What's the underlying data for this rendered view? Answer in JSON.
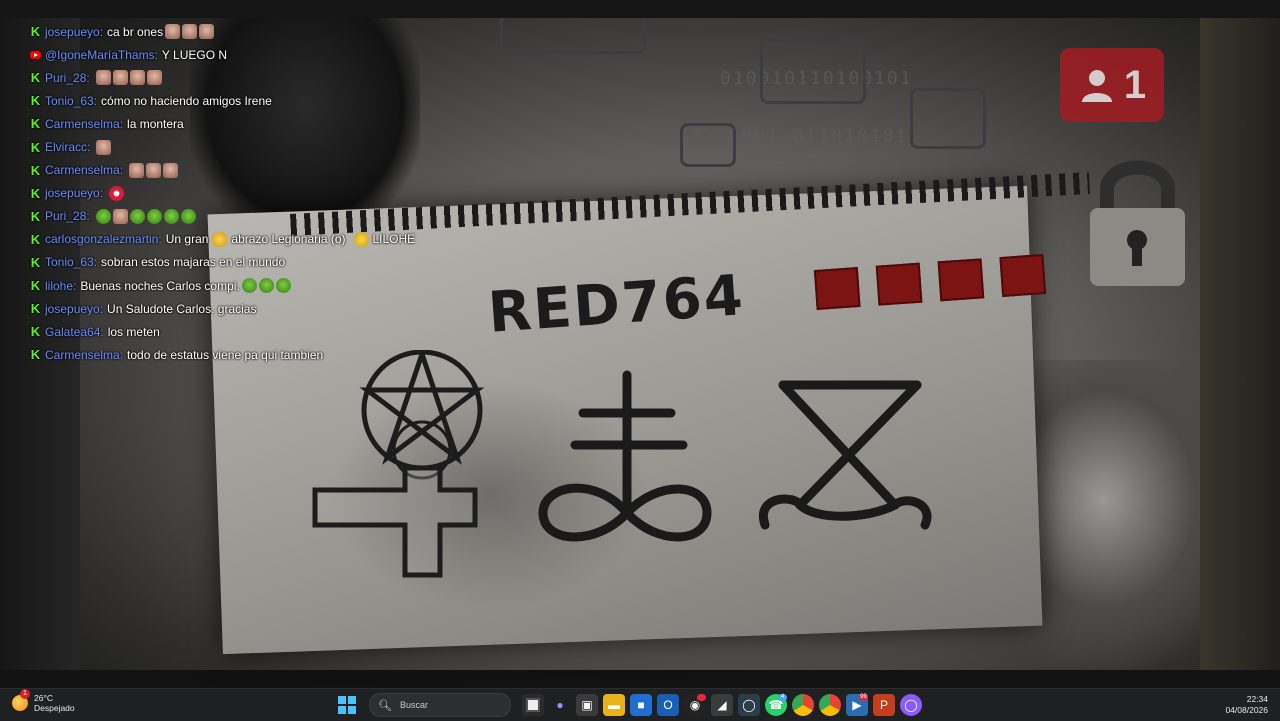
{
  "video": {
    "title_text": "RED764",
    "notify_count": "1"
  },
  "chat": {
    "messages": [
      {
        "platform": "kick",
        "user": "josepueyo:",
        "text": "ca br ones",
        "emotes": [
          "face",
          "face",
          "face"
        ]
      },
      {
        "platform": "youtube",
        "user": "@IgoneMaríaThams:",
        "text": "Y LUEGO N",
        "emotes": []
      },
      {
        "platform": "kick",
        "user": "Puri_28:",
        "text": "",
        "emotes": [
          "face",
          "face",
          "face",
          "face"
        ]
      },
      {
        "platform": "kick",
        "user": "Tonio_63:",
        "text": "cómo no haciendo amigos Irene",
        "emotes": []
      },
      {
        "platform": "kick",
        "user": "Carmenselma:",
        "text": "la montera",
        "emotes": []
      },
      {
        "platform": "kick",
        "user": "Elviracc:",
        "text": "",
        "emotes": [
          "face"
        ]
      },
      {
        "platform": "kick",
        "user": "Carmenselma:",
        "text": "",
        "emotes": [
          "face",
          "face",
          "face"
        ]
      },
      {
        "platform": "kick",
        "user": "josepueyo:",
        "text": "",
        "emotes": [
          "red"
        ]
      },
      {
        "platform": "kick",
        "user": "Puri_28:",
        "text": "",
        "emotes": [
          "green",
          "face",
          "green",
          "green",
          "green",
          "green"
        ]
      },
      {
        "platform": "kick",
        "user": "carlosgonzalezmartin:",
        "text": "Un gran",
        "text2": "abrazo Legionaria (o)",
        "text3": "LILOHE",
        "emotes": []
      },
      {
        "platform": "kick",
        "user": "Tonio_63:",
        "text": "sobran estos majaras en el mundo",
        "emotes": []
      },
      {
        "platform": "kick",
        "user": "lilohe:",
        "text": "Buenas noches Carlos compi.",
        "emotes": [
          "green",
          "green",
          "green"
        ]
      },
      {
        "platform": "kick",
        "user": "josepueyo:",
        "text": "Un Saludote Carlos. gracias",
        "emotes": []
      },
      {
        "platform": "kick",
        "user": "Galatea64:",
        "text": "los meten",
        "emotes": []
      },
      {
        "platform": "kick",
        "user": "Carmenselma:",
        "text": "todo de estatus viene pa qui tambien",
        "emotes": []
      }
    ]
  },
  "taskbar": {
    "weather_temp": "26°C",
    "weather_desc": "Despejado",
    "weather_badge": "1",
    "search_placeholder": "Buscar",
    "time": "22:34",
    "date": "04/08/2026",
    "badge_whatsapp": "4",
    "badge_misc": "99"
  },
  "colors": {
    "username": "#6b8cff",
    "kick": "#53fc18",
    "youtube": "#ff0000"
  }
}
